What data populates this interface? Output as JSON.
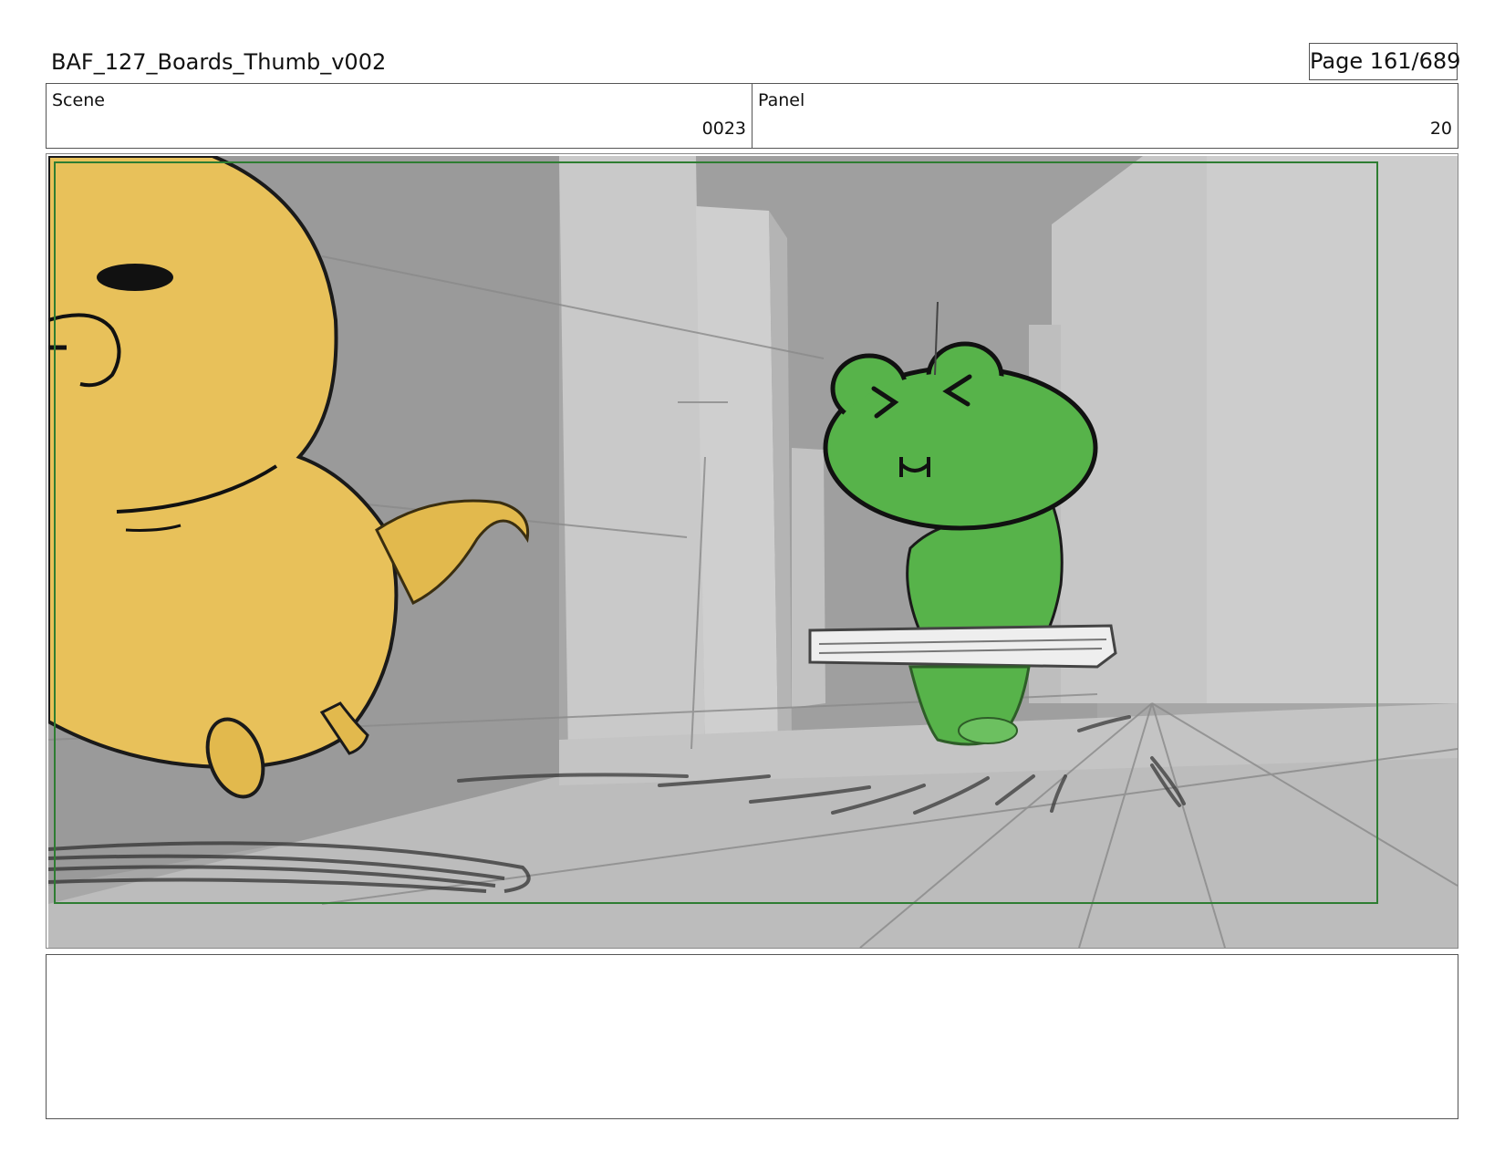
{
  "header": {
    "title": "BAF_127_Boards_Thumb_v002",
    "page": "Page 161/689"
  },
  "info": {
    "scene_label": "Scene",
    "scene_value": "0023",
    "panel_label": "Panel",
    "panel_value": "20"
  },
  "panel": {
    "safe_frame_color": "#2e7d32",
    "characters": [
      "yellow-duck-character",
      "green-frog-character"
    ],
    "colors": {
      "duck": "#e8c15a",
      "frog": "#57b34a",
      "wall_light": "#cfd0d0",
      "wall_mid": "#a9a9a9",
      "floor": "#bdbdbd"
    }
  },
  "notes": {
    "text": ""
  }
}
